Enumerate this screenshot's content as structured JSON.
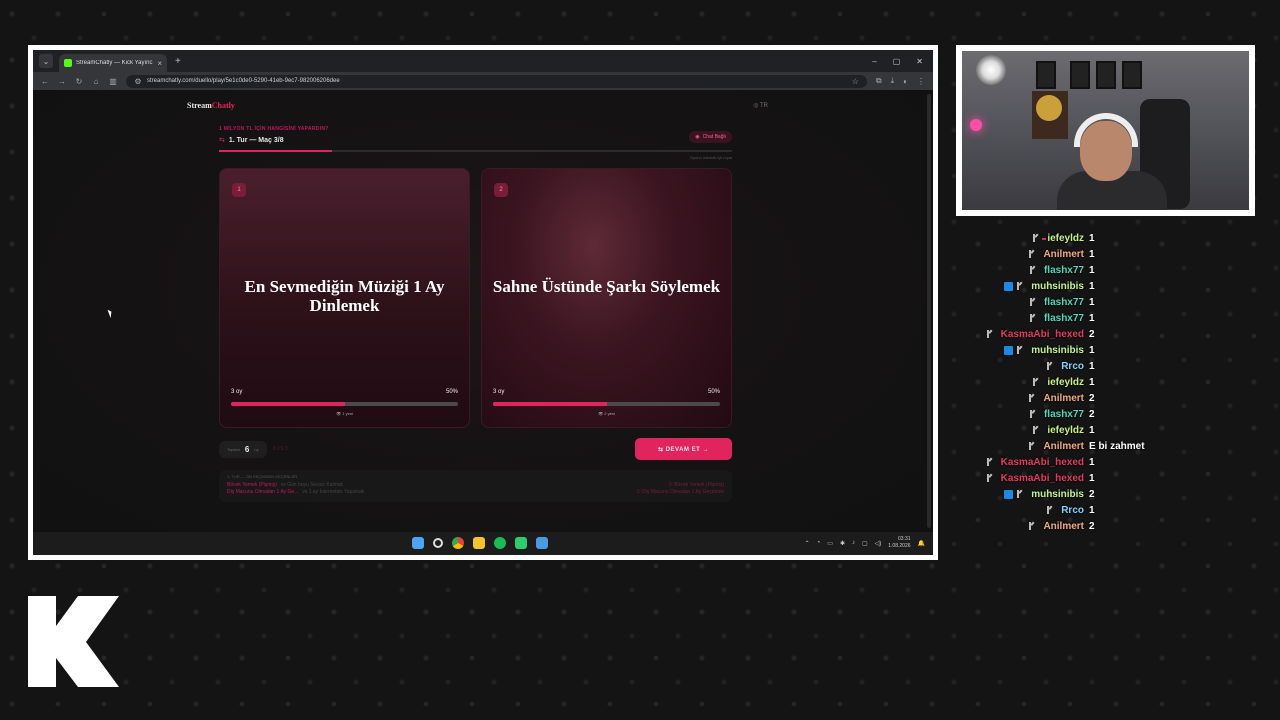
{
  "browser": {
    "tab_title": "StreamChatly — Kick Yayıncılar",
    "url": "streamchatly.com/duello/play/5e1c0de0-5290-41eb-9ec7-982006206dee"
  },
  "site": {
    "logo": "Stream",
    "logo_accent": "Chatly",
    "language": "◎ TR"
  },
  "game": {
    "subtitle": "1 MİLYON TL İÇİN HANGİSİNİ YAPARDIN?",
    "round_label": "1. Tur — Maç 3/8",
    "chat_button": "Chat Bağlı",
    "hint": "Oyunu izlemek için oyla",
    "progress_pct": 0.22,
    "cards": [
      {
        "num": "1",
        "title": "En Sevmediğin Müziği 1 Ay Dinlemek",
        "left_stat": "3 oy",
        "pct_label": "50%",
        "pct": 0.5,
        "votes": "👁 1 yeni"
      },
      {
        "num": "2",
        "title": "Sahne Üstünde Şarkı Söylemek",
        "left_stat": "3 oy",
        "pct_label": "50%",
        "pct": 0.5,
        "votes": "👁 2 yeni"
      }
    ],
    "kept_label": "Toplam",
    "kept_value": "6",
    "kept_unit": "oy",
    "vs_label": "3 VS 3",
    "continue_button": "⇆  DEVAM ET  →",
    "history": {
      "title": "1. TUR — ÖN SEÇİMDEN GEÇENLER",
      "rows": [
        {
          "left": "Böcek Yemek (Pişmiş)",
          "mid": "vs  Gün boyu Sessiz Kalmak",
          "right": "① Böcek Yemek (Pişmiş)"
        },
        {
          "left": "Diş Macunu Olmadan 1 Ay Ge...",
          "mid": "vs  1 ay İnternetsiz Yaşamak",
          "right": "① Diş Macunu Olmadan 1 Ay Geçirmek"
        }
      ]
    }
  },
  "taskbar": {
    "time": "03:31",
    "date": "1.08.2026"
  },
  "chat": [
    {
      "user": "iefeyldz",
      "color": "#c6f28a",
      "text": "1",
      "sub": false
    },
    {
      "user": "Anilmert",
      "color": "#f4a97c",
      "text": "1",
      "sub": false
    },
    {
      "user": "flashx77",
      "color": "#52d6b8",
      "text": "1",
      "sub": false
    },
    {
      "user": "muhsinibis",
      "color": "#c6f28a",
      "text": "1",
      "sub": true
    },
    {
      "user": "flashx77",
      "color": "#52d6b8",
      "text": "1",
      "sub": false
    },
    {
      "user": "flashx77",
      "color": "#52d6b8",
      "text": "1",
      "sub": false
    },
    {
      "user": "KasmaAbi_hexed",
      "color": "#e5395f",
      "text": "2",
      "sub": false
    },
    {
      "user": "muhsinibis",
      "color": "#c6f28a",
      "text": "1",
      "sub": true
    },
    {
      "user": "Rrco",
      "color": "#7fd4ff",
      "text": "1",
      "sub": false
    },
    {
      "user": "iefeyldz",
      "color": "#c6f28a",
      "text": "1",
      "sub": false
    },
    {
      "user": "Anilmert",
      "color": "#f4a97c",
      "text": "2",
      "sub": false
    },
    {
      "user": "flashx77",
      "color": "#52d6b8",
      "text": "2",
      "sub": false
    },
    {
      "user": "iefeyldz",
      "color": "#c6f28a",
      "text": "1",
      "sub": false
    },
    {
      "user": "Anilmert",
      "color": "#f4a97c",
      "text": "E bi zahmet",
      "sub": false
    },
    {
      "user": "KasmaAbi_hexed",
      "color": "#e5395f",
      "text": "1",
      "sub": false
    },
    {
      "user": "KasmaAbi_hexed",
      "color": "#e5395f",
      "text": "1",
      "sub": false
    },
    {
      "user": "muhsinibis",
      "color": "#c6f28a",
      "text": "2",
      "sub": true
    },
    {
      "user": "Rrco",
      "color": "#7fd4ff",
      "text": "1",
      "sub": false
    },
    {
      "user": "Anilmert",
      "color": "#f4a97c",
      "text": "2",
      "sub": false
    }
  ],
  "icons": {
    "kick_logo": "kick-logo-icon"
  }
}
